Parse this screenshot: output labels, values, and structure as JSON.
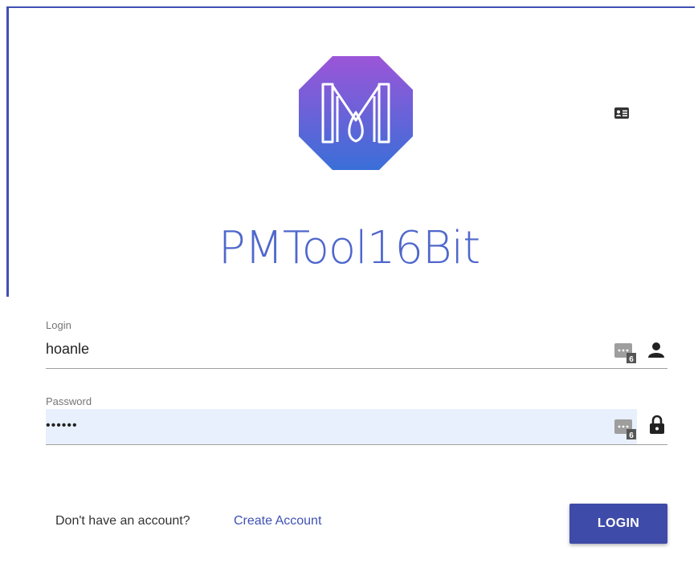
{
  "app": {
    "title": "PMTool16Bit",
    "accent_color": "#3f51b5"
  },
  "icons": {
    "logo": "app-logo-m",
    "header_right": "id-card-icon",
    "password_manager": "password-manager-icon",
    "password_manager_badge": "6",
    "login_trailing": "person-icon",
    "password_trailing": "lock-icon"
  },
  "form": {
    "login": {
      "label": "Login",
      "value": "hoanle"
    },
    "password": {
      "label": "Password",
      "value": "••••••"
    }
  },
  "footer": {
    "prompt": "Don't have an account?",
    "create_link": "Create Account",
    "login_button": "LOGIN"
  }
}
